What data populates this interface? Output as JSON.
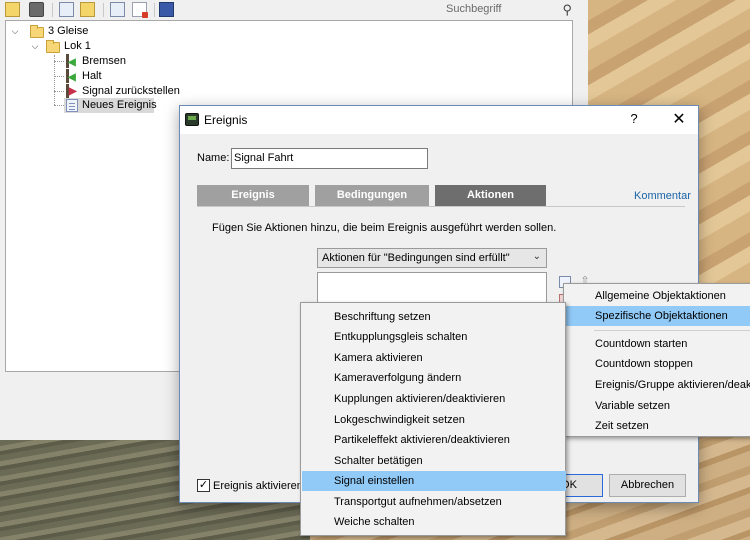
{
  "toolbar": {
    "icons": [
      "new-folder-icon",
      "comment-icon",
      "new-document-icon",
      "edit-document-icon",
      "copy-icon",
      "delete-icon",
      "save-icon"
    ],
    "search_placeholder": "Suchbegriff"
  },
  "tree": {
    "root_label": "3 Gleise",
    "child_label": "Lok 1",
    "nodes": [
      {
        "label": "Bremsen"
      },
      {
        "label": "Halt"
      },
      {
        "label": "Signal zurückstellen"
      },
      {
        "label": "Neues Ereignis"
      }
    ]
  },
  "dialog": {
    "title": "Ereignis",
    "help": "?",
    "close": "✕",
    "name_label": "Name:",
    "name_value": "Signal Fahrt",
    "tabs": [
      {
        "label": "Ereignis"
      },
      {
        "label": "Bedingungen"
      },
      {
        "label": "Aktionen"
      }
    ],
    "comment_link": "Kommentar",
    "instruction": "Fügen Sie Aktionen hinzu, die beim Ereignis ausgeführt werden sollen.",
    "action_select": "Aktionen für \"Bedingungen sind erfüllt\"",
    "activate_label": "Ereignis aktivieren",
    "activate_checked": true,
    "ok_label": "OK",
    "cancel_label": "Abbrechen"
  },
  "submenu": {
    "items": [
      {
        "label": "Beschriftung setzen"
      },
      {
        "label": "Entkupplungsgleis schalten"
      },
      {
        "label": "Kamera aktivieren"
      },
      {
        "label": "Kameraverfolgung ändern"
      },
      {
        "label": "Kupplungen aktivieren/deaktivieren"
      },
      {
        "label": "Lokgeschwindigkeit setzen"
      },
      {
        "label": "Partikeleffekt aktivieren/deaktivieren"
      },
      {
        "label": "Schalter betätigen"
      },
      {
        "label": "Signal einstellen"
      },
      {
        "label": "Transportgut aufnehmen/absetzen"
      },
      {
        "label": "Weiche schalten"
      }
    ],
    "highlighted": "Signal einstellen"
  },
  "main_menu": {
    "items": [
      {
        "label": "Allgemeine Objektaktionen"
      },
      {
        "label": "Spezifische Objektaktionen"
      },
      {
        "label": "Countdown starten"
      },
      {
        "label": "Countdown stoppen"
      },
      {
        "label": "Ereignis/Gruppe aktivieren/deaktivieren"
      },
      {
        "label": "Variable setzen"
      },
      {
        "label": "Zeit setzen"
      }
    ],
    "highlighted": "Spezifische Objektaktionen"
  },
  "colors": {
    "menu_highlight": "#91c9f7",
    "active_tab": "#6e6e6e",
    "inactive_tab": "#a0a0a0",
    "link": "#1a64a8"
  }
}
